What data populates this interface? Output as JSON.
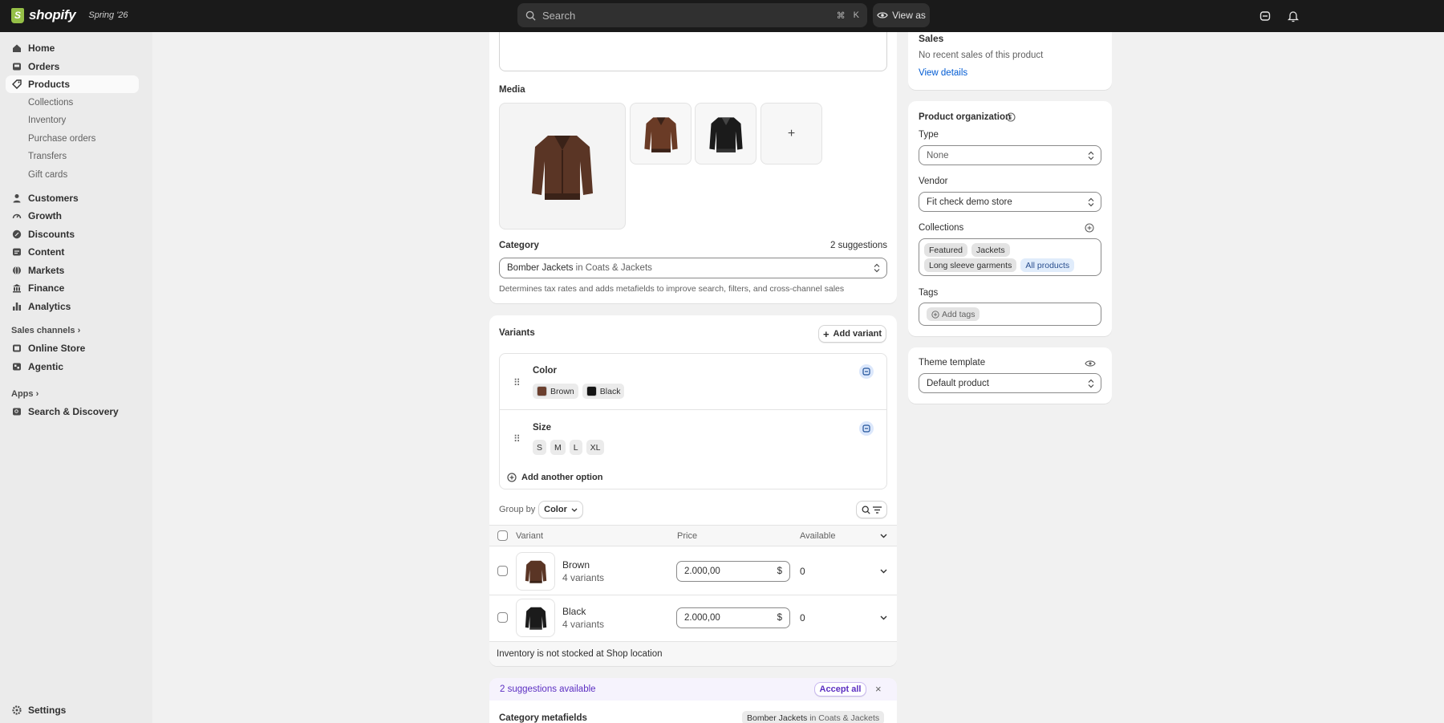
{
  "topbar": {
    "brand": "shopify",
    "edition": "Spring '26",
    "search_placeholder": "Search",
    "shortcut_cmd": "⌘",
    "shortcut_key": "K",
    "view_as": "View as"
  },
  "sidebar": {
    "home": "Home",
    "orders": "Orders",
    "products": "Products",
    "product_subitems": [
      "Collections",
      "Inventory",
      "Purchase orders",
      "Transfers",
      "Gift cards"
    ],
    "customers": "Customers",
    "growth": "Growth",
    "discounts": "Discounts",
    "content": "Content",
    "markets": "Markets",
    "finance": "Finance",
    "analytics": "Analytics",
    "sales_channels": "Sales channels",
    "online_store": "Online Store",
    "agentic": "Agentic",
    "apps": "Apps",
    "search_discovery": "Search & Discovery",
    "settings": "Settings"
  },
  "media": {
    "label": "Media",
    "add_symbol": "+"
  },
  "category": {
    "label": "Category",
    "suggestions": "2 suggestions",
    "value_bold": "Bomber Jackets",
    "value_rest": " in Coats & Jackets",
    "help": "Determines tax rates and adds metafields to improve search, filters, and cross-channel sales"
  },
  "variants": {
    "title": "Variants",
    "add_variant": "Add variant",
    "color_label": "Color",
    "color_values": [
      {
        "name": "Brown",
        "color": "#6b3f2e"
      },
      {
        "name": "Black",
        "color": "#141414"
      }
    ],
    "size_label": "Size",
    "size_values": [
      "S",
      "M",
      "L",
      "XL"
    ],
    "add_option": "Add another option",
    "group_by_label": "Group by",
    "group_by_value": "Color",
    "col_variant": "Variant",
    "col_price": "Price",
    "col_available": "Available",
    "rows": [
      {
        "name": "Brown",
        "sub": "4 variants",
        "price": "2.000,00",
        "currency": "$",
        "available": "0"
      },
      {
        "name": "Black",
        "sub": "4 variants",
        "price": "2.000,00",
        "currency": "$",
        "available": "0"
      }
    ],
    "inventory_note": "Inventory is not stocked at Shop location"
  },
  "suggestions_bar": {
    "text": "2 suggestions available",
    "accept": "Accept all",
    "close": "×"
  },
  "metafields": {
    "title": "Category metafields",
    "badge_bold": "Bomber Jackets",
    "badge_rest": " in Coats & Jackets"
  },
  "sales": {
    "title": "Sales",
    "text": "No recent sales of this product",
    "link": "View details"
  },
  "organization": {
    "title": "Product organization",
    "type_label": "Type",
    "type_value": "None",
    "vendor_label": "Vendor",
    "vendor_value": "Fit check demo store",
    "collections_label": "Collections",
    "collections": [
      "Featured",
      "Jackets",
      "Long sleeve garments"
    ],
    "collection_highlight": "All products",
    "tags_label": "Tags",
    "tags_placeholder": "Add tags"
  },
  "theme": {
    "label": "Theme template",
    "value": "Default product"
  },
  "colors": {
    "accent_link": "#005bd3",
    "suggestion_purple": "#5c2fc2"
  }
}
